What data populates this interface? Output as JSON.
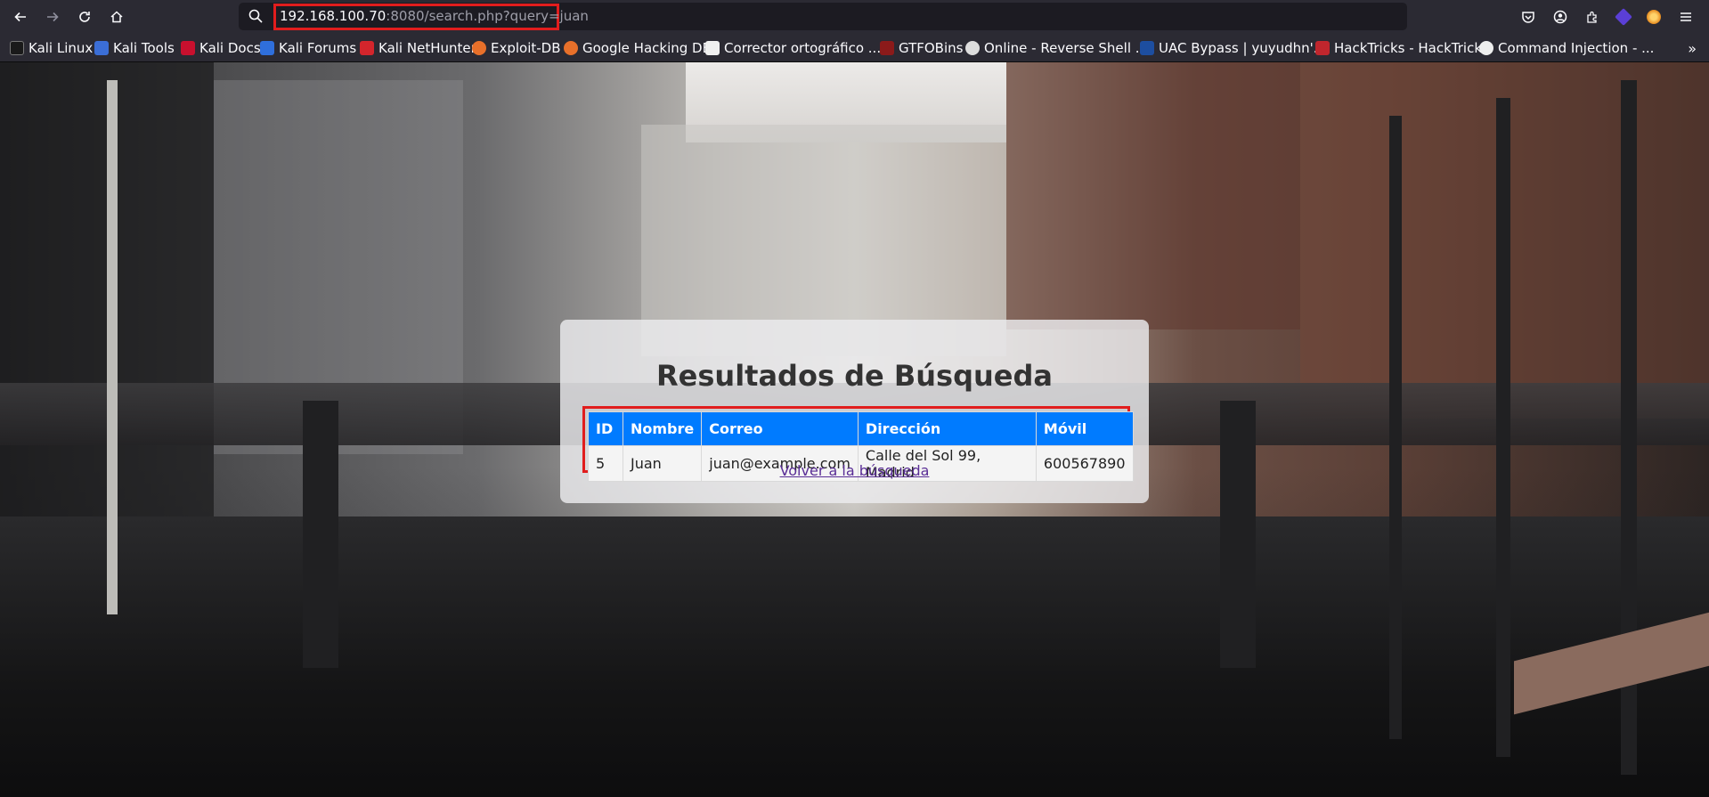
{
  "browser": {
    "url": {
      "host": "192.168.100.70",
      "rest": ":8080/search.php?query=juan"
    },
    "icons": {
      "back": "back-arrow-icon",
      "forward": "forward-arrow-icon",
      "reload": "reload-icon",
      "home": "home-icon",
      "search": "search-icon",
      "pocket": "pocket-icon",
      "account": "account-icon",
      "extensions": "extensions-icon",
      "menu": "hamburger-menu-icon"
    },
    "bookmarks": [
      {
        "label": "Kali Linux",
        "icon": "kali-icon",
        "color": "#1a1a1a"
      },
      {
        "label": "Kali Tools",
        "icon": "kali-tools-icon",
        "color": "#3b6ed6"
      },
      {
        "label": "Kali Docs",
        "icon": "kali-docs-icon",
        "color": "#c8102e"
      },
      {
        "label": "Kali Forums",
        "icon": "kali-forums-icon",
        "color": "#2f6fdc"
      },
      {
        "label": "Kali NetHunter",
        "icon": "nethunter-icon",
        "color": "#d3252c"
      },
      {
        "label": "Exploit-DB",
        "icon": "exploit-db-icon",
        "color": "#e8702a"
      },
      {
        "label": "Google Hacking DB",
        "icon": "ghdb-icon",
        "color": "#e8702a"
      },
      {
        "label": "Corrector ortográfico ...",
        "icon": "page-icon",
        "color": "#f0f0f0"
      },
      {
        "label": "GTFOBins",
        "icon": "gtfobins-icon",
        "color": "#8b1a1a"
      },
      {
        "label": "Online - Reverse Shell ...",
        "icon": "skull-icon",
        "color": "#dddddd"
      },
      {
        "label": "UAC Bypass | yuyudhn'...",
        "icon": "uac-icon",
        "color": "#1d4ea0"
      },
      {
        "label": "HackTricks - HackTricks",
        "icon": "hacktricks-icon",
        "color": "#c0262d"
      },
      {
        "label": "Command Injection - ...",
        "icon": "cmd-injection-icon",
        "color": "#eeeeee"
      }
    ],
    "more_bookmarks": "»"
  },
  "page": {
    "title": "Resultados de Búsqueda",
    "table": {
      "headers": [
        "ID",
        "Nombre",
        "Correo",
        "Dirección",
        "Móvil"
      ],
      "rows": [
        [
          "5",
          "Juan",
          "juan@example.com",
          "Calle del Sol 99, Madrid",
          "600567890"
        ]
      ]
    },
    "back_link": "Volver a la búsqueda",
    "accent_color": "#007bff",
    "highlight_color": "#e11d1d"
  }
}
